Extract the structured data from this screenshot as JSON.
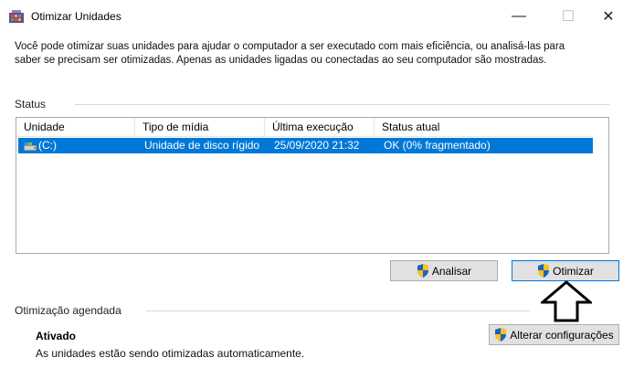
{
  "window": {
    "title": "Otimizar Unidades",
    "controls": {
      "minimize": "—",
      "maximize": "☐",
      "close": "✕"
    }
  },
  "description": "Você pode otimizar suas unidades para ajudar o computador a ser executado com mais eficiência, ou analisá-las para saber se precisam ser otimizadas. Apenas as unidades ligadas ou conectadas ao seu computador são mostradas.",
  "status": {
    "label": "Status",
    "columns": [
      "Unidade",
      "Tipo de mídia",
      "Última execução",
      "Status atual"
    ],
    "rows": [
      {
        "drive": "(C:)",
        "media_type": "Unidade de disco rígido",
        "last_run": "25/09/2020 21:32",
        "current_status": "OK (0% fragmentado)",
        "selected": true
      }
    ],
    "selection_color": "#0078d7"
  },
  "actions": {
    "analyze_label": "Analisar",
    "optimize_label": "Otimizar"
  },
  "scheduled": {
    "label": "Otimização agendada",
    "state": "Ativado",
    "status_text": "As unidades estão sendo otimizadas automaticamente.",
    "change_settings_label": "Alterar configurações"
  },
  "icons": {
    "app": "defrag-icon",
    "drive": "hard-drive-icon",
    "uac": "uac-shield-icon",
    "annotation": "up-arrow-icon"
  }
}
